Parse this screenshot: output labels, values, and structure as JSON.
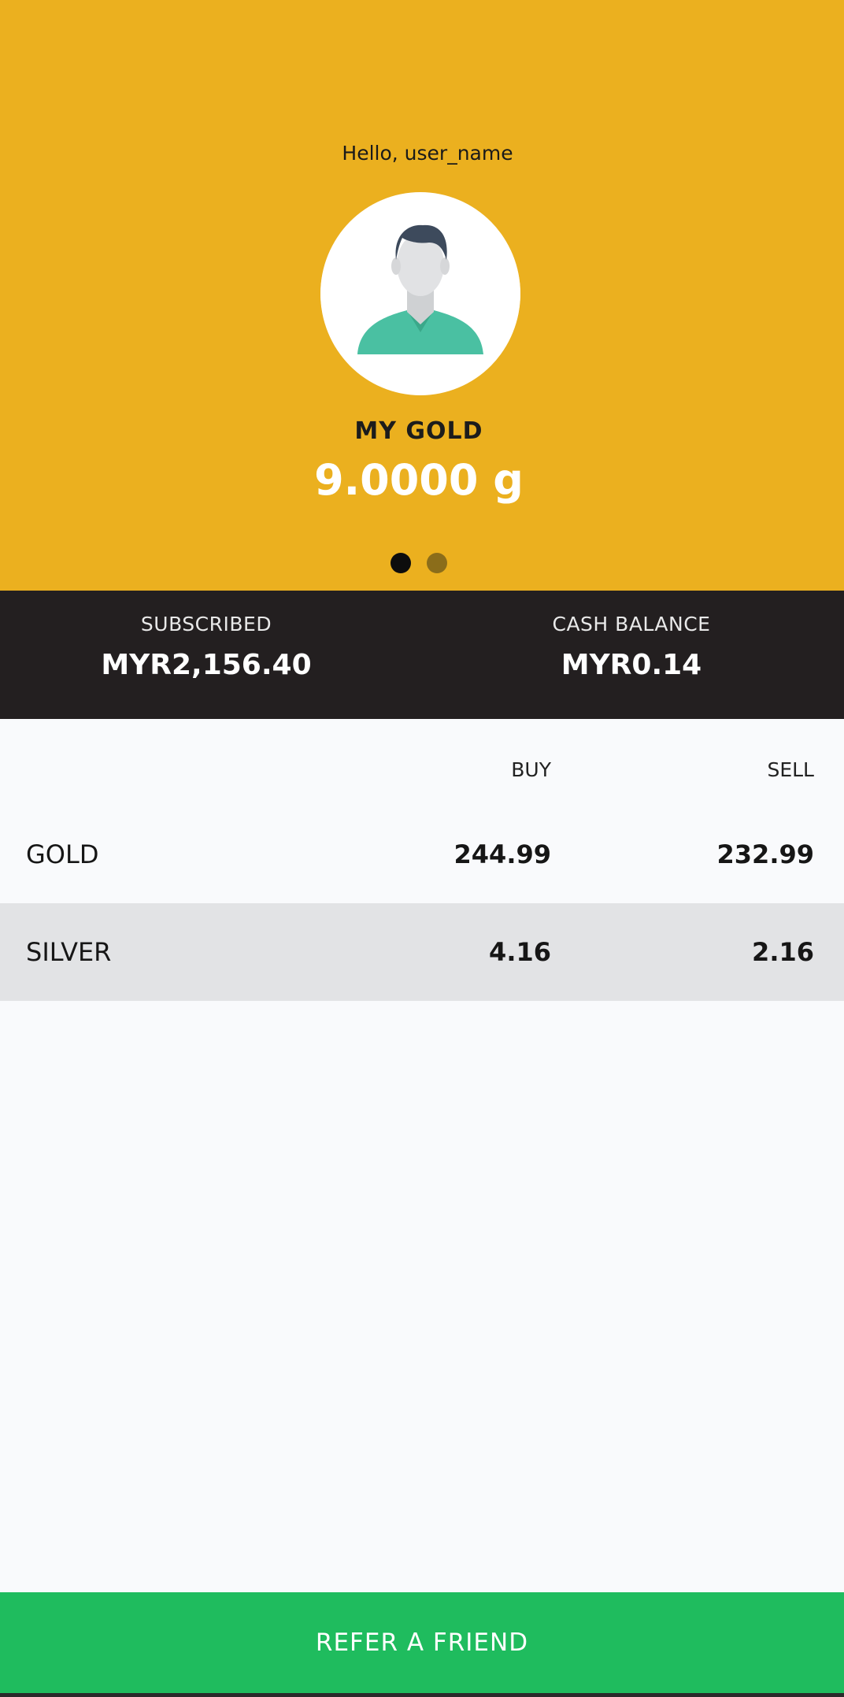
{
  "header": {
    "greeting": "Hello, user_name",
    "avatar_icon": "user-avatar-icon",
    "my_gold_label": "MY GOLD",
    "my_gold_value": "9.0000 g",
    "carousel": {
      "pages": 2,
      "active_index": 0
    },
    "background_color": "#ebb01f"
  },
  "balances": {
    "subscribed_label": "SUBSCRIBED",
    "subscribed_value": "MYR2,156.40",
    "cash_balance_label": "CASH BALANCE",
    "cash_balance_value": "MYR0.14"
  },
  "prices": {
    "columns": {
      "buy": "BUY",
      "sell": "SELL"
    },
    "rows": [
      {
        "name": "GOLD",
        "buy": "244.99",
        "sell": "232.99"
      },
      {
        "name": "SILVER",
        "buy": "4.16",
        "sell": "2.16"
      }
    ]
  },
  "footer": {
    "refer_label": "REFER A FRIEND",
    "button_color": "#1fbc5e"
  }
}
